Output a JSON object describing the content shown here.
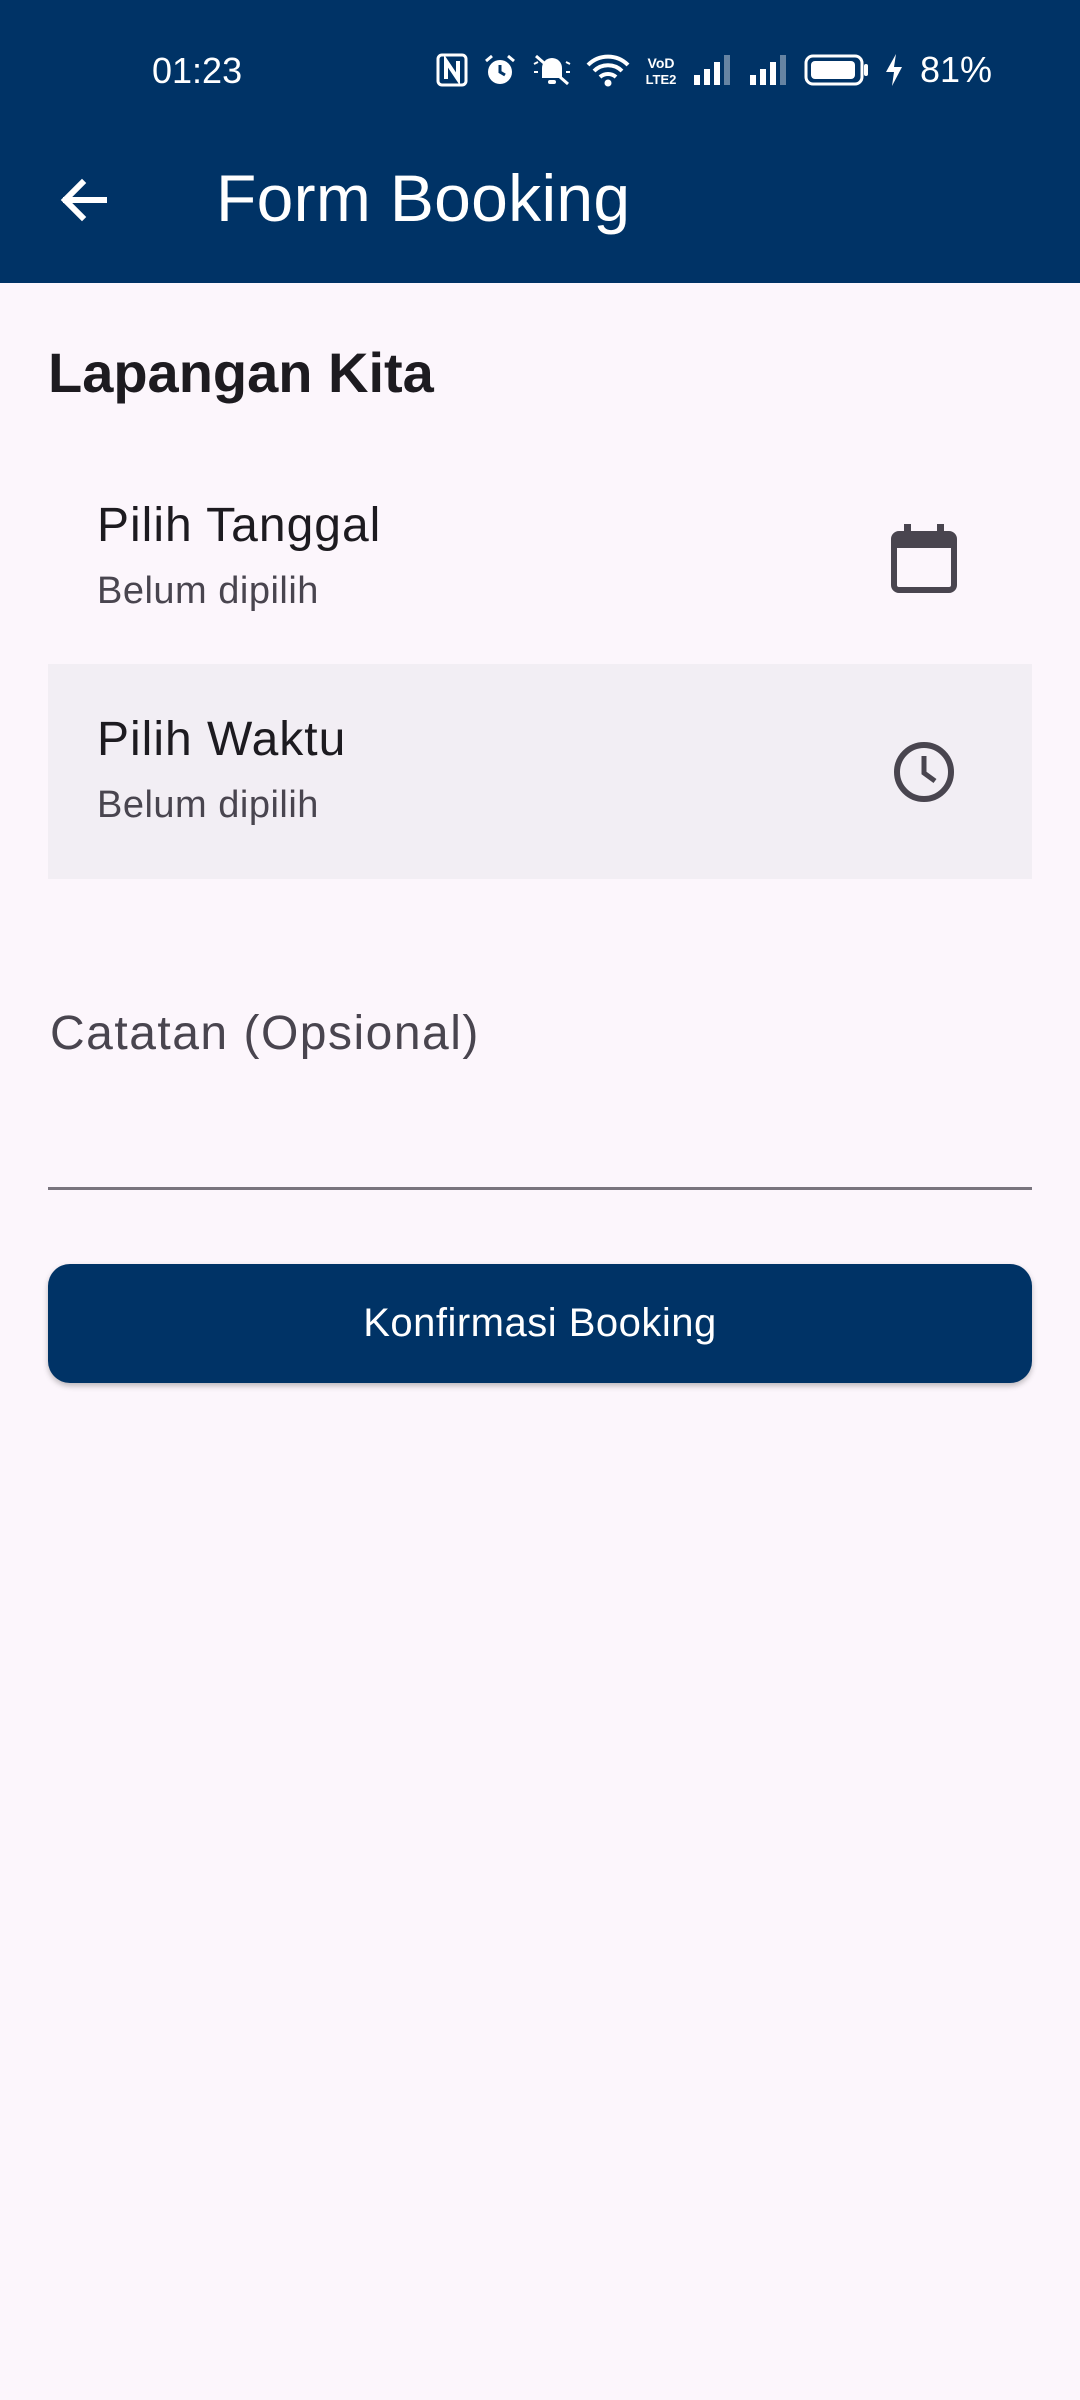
{
  "status_bar": {
    "time": "01:23",
    "battery_percent": "81%",
    "icons": [
      "nfc-icon",
      "alarm-icon",
      "mute-icon",
      "wifi-icon",
      "volte-icon",
      "signal-icon",
      "signal-icon",
      "battery-icon",
      "charging-icon"
    ]
  },
  "app_bar": {
    "back_icon": "arrow-left-icon",
    "title": "Form Booking"
  },
  "venue": {
    "name": "Lapangan Kita"
  },
  "date_picker": {
    "title": "Pilih Tanggal",
    "value": "Belum dipilih",
    "icon": "calendar-icon"
  },
  "time_picker": {
    "title": "Pilih Waktu",
    "value": "Belum dipilih",
    "icon": "clock-icon"
  },
  "notes": {
    "label": "Catatan (Opsional)",
    "value": ""
  },
  "confirm_button": {
    "label": "Konfirmasi Booking"
  },
  "colors": {
    "primary": "#003366",
    "background": "#fcf6fc",
    "tile_selected": "#f2eef4"
  }
}
